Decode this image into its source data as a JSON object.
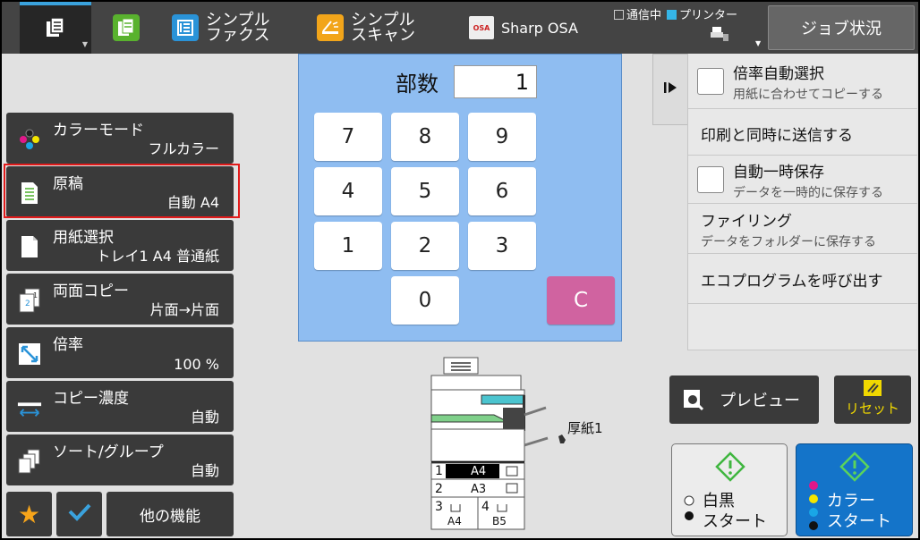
{
  "topbar": {
    "modes": [
      {
        "label": ""
      },
      {
        "label": ""
      },
      {
        "label": "シンプル\nファクス"
      },
      {
        "label": "シンプル\nスキャン"
      },
      {
        "label": "Sharp OSA"
      }
    ],
    "status": {
      "comm": "通信中",
      "printer": "プリンター"
    },
    "job_status": "ジョブ状況",
    "osa_logo": "OSA"
  },
  "functions": [
    {
      "title": "カラーモード",
      "value": "フルカラー"
    },
    {
      "title": "原稿",
      "value": "自動 A4"
    },
    {
      "title": "用紙選択",
      "value": "トレイ1 A4 普通紙"
    },
    {
      "title": "両面コピー",
      "value": "片面→片面"
    },
    {
      "title": "倍率",
      "value": "100 %"
    },
    {
      "title": "コピー濃度",
      "value": "自動"
    },
    {
      "title": "ソート/グループ",
      "value": "自動"
    }
  ],
  "bottom_keys": {
    "other": "他の機能"
  },
  "copies": {
    "label": "部数",
    "value": "1"
  },
  "keypad": {
    "k7": "7",
    "k8": "8",
    "k9": "9",
    "k4": "4",
    "k5": "5",
    "k6": "6",
    "k1": "1",
    "k2": "2",
    "k3": "3",
    "k0": "0",
    "clear": "C"
  },
  "right_menu": [
    {
      "title": "倍率自動選択",
      "sub": "用紙に合わせてコピーする"
    },
    {
      "title": "印刷と同時に送信する"
    },
    {
      "title": "自動一時保存",
      "sub": "データを一時的に保存する"
    },
    {
      "title": "ファイリング",
      "sub": "データをフォルダーに保存する"
    },
    {
      "title": "エコプログラムを呼び出す"
    }
  ],
  "machine": {
    "bypass_label": "厚紙1",
    "trays": [
      {
        "num": "1",
        "size": "A4"
      },
      {
        "num": "2",
        "size": "A3"
      },
      {
        "num": "3",
        "size": "A4"
      },
      {
        "num": "4",
        "size": "B5"
      }
    ]
  },
  "actions": {
    "preview": "プレビュー",
    "reset": "リセット",
    "bw_start": "白黒\nスタート",
    "color_start": "カラー\nスタート"
  },
  "colors": {
    "accent": "#3aa2dd",
    "selected_border": "#e21a1a",
    "keypad_bg": "#8fbdf1",
    "clear_key": "#d063a0",
    "color_start": "#1474c9",
    "reset_text": "#f0d800"
  }
}
